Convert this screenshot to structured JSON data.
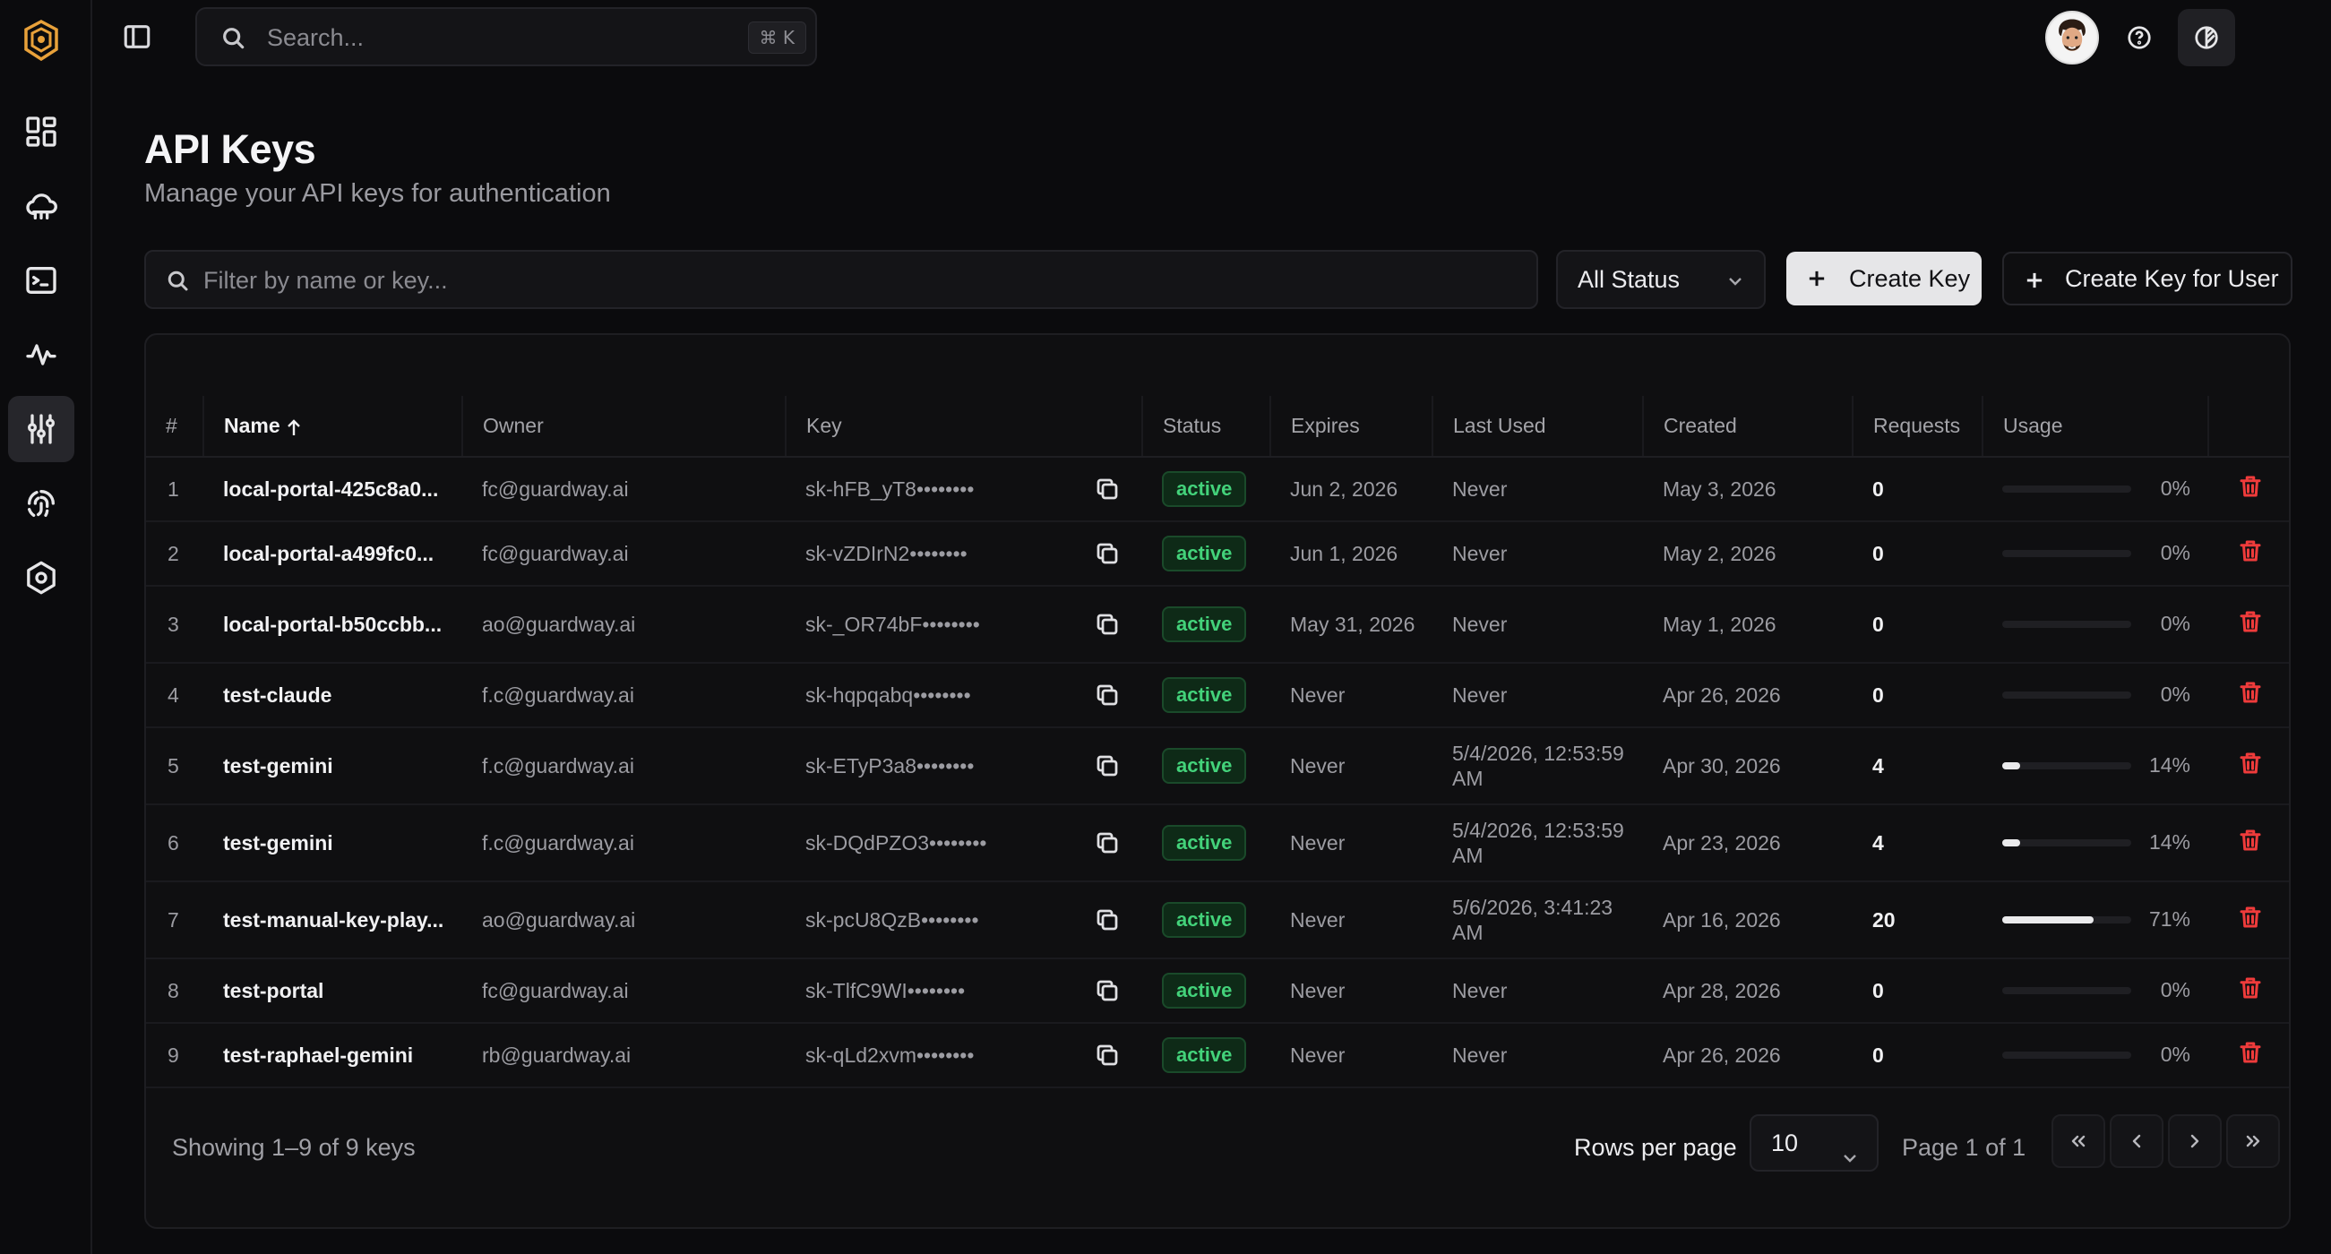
{
  "topbar": {
    "search_placeholder": "Search...",
    "search_shortcut": "⌘ K"
  },
  "page": {
    "title": "API Keys",
    "subtitle": "Manage your API keys for authentication"
  },
  "toolbar": {
    "filter_placeholder": "Filter by name or key...",
    "status_filter": "All Status",
    "create_key_label": "Create Key",
    "create_key_for_user_label": "Create Key for User"
  },
  "table": {
    "columns": {
      "index": "#",
      "name": "Name",
      "owner": "Owner",
      "key": "Key",
      "status": "Status",
      "expires": "Expires",
      "last_used": "Last Used",
      "created": "Created",
      "requests": "Requests",
      "usage": "Usage"
    },
    "rows": [
      {
        "index": "1",
        "name": "local-portal-425c8a0...",
        "owner": "fc@guardway.ai",
        "key": "sk-hFB_yT8••••••••",
        "status": "active",
        "expires": "Jun 2, 2026",
        "last_used": "Never",
        "created": "May 3, 2026",
        "requests": "0",
        "usage_pct": "0%",
        "usage": 0
      },
      {
        "index": "2",
        "name": "local-portal-a499fc0...",
        "owner": "fc@guardway.ai",
        "key": "sk-vZDIrN2••••••••",
        "status": "active",
        "expires": "Jun 1, 2026",
        "last_used": "Never",
        "created": "May 2, 2026",
        "requests": "0",
        "usage_pct": "0%",
        "usage": 0
      },
      {
        "index": "3",
        "name": "local-portal-b50ccbb...",
        "owner": "ao@guardway.ai",
        "key": "sk-_OR74bF••••••••",
        "status": "active",
        "expires": "May 31, 2026",
        "last_used": "Never",
        "created": "May 1, 2026",
        "requests": "0",
        "usage_pct": "0%",
        "usage": 0
      },
      {
        "index": "4",
        "name": "test-claude",
        "owner": "f.c@guardway.ai",
        "key": "sk-hqpqabq••••••••",
        "status": "active",
        "expires": "Never",
        "last_used": "Never",
        "created": "Apr 26, 2026",
        "requests": "0",
        "usage_pct": "0%",
        "usage": 0
      },
      {
        "index": "5",
        "name": "test-gemini",
        "owner": "f.c@guardway.ai",
        "key": "sk-ETyP3a8••••••••",
        "status": "active",
        "expires": "Never",
        "last_used": "5/4/2026, 12:53:59 AM",
        "created": "Apr 30, 2026",
        "requests": "4",
        "usage_pct": "14%",
        "usage": 0.14
      },
      {
        "index": "6",
        "name": "test-gemini",
        "owner": "f.c@guardway.ai",
        "key": "sk-DQdPZO3••••••••",
        "status": "active",
        "expires": "Never",
        "last_used": "5/4/2026, 12:53:59 AM",
        "created": "Apr 23, 2026",
        "requests": "4",
        "usage_pct": "14%",
        "usage": 0.14
      },
      {
        "index": "7",
        "name": "test-manual-key-play...",
        "owner": "ao@guardway.ai",
        "key": "sk-pcU8QzB••••••••",
        "status": "active",
        "expires": "Never",
        "last_used": "5/6/2026, 3:41:23 AM",
        "created": "Apr 16, 2026",
        "requests": "20",
        "usage_pct": "71%",
        "usage": 0.71
      },
      {
        "index": "8",
        "name": "test-portal",
        "owner": "fc@guardway.ai",
        "key": "sk-TlfC9WI••••••••",
        "status": "active",
        "expires": "Never",
        "last_used": "Never",
        "created": "Apr 28, 2026",
        "requests": "0",
        "usage_pct": "0%",
        "usage": 0
      },
      {
        "index": "9",
        "name": "test-raphael-gemini",
        "owner": "rb@guardway.ai",
        "key": "sk-qLd2xvm••••••••",
        "status": "active",
        "expires": "Never",
        "last_used": "Never",
        "created": "Apr 26, 2026",
        "requests": "0",
        "usage_pct": "0%",
        "usage": 0
      }
    ]
  },
  "footer": {
    "showing": "Showing 1–9 of 9 keys",
    "rows_per_page_label": "Rows per page",
    "rows_per_page": "10",
    "page_info": "Page 1 of 1"
  },
  "icons": {
    "nav": [
      "dashboard-icon",
      "cloud-icon",
      "terminal-icon",
      "activity-icon",
      "sliders-icon",
      "fingerprint-icon",
      "settings-hexagon-icon"
    ]
  },
  "colors": {
    "accent_logo": "#e8a13a",
    "status_active": "#43d27a",
    "delete": "#ef3b3b"
  }
}
